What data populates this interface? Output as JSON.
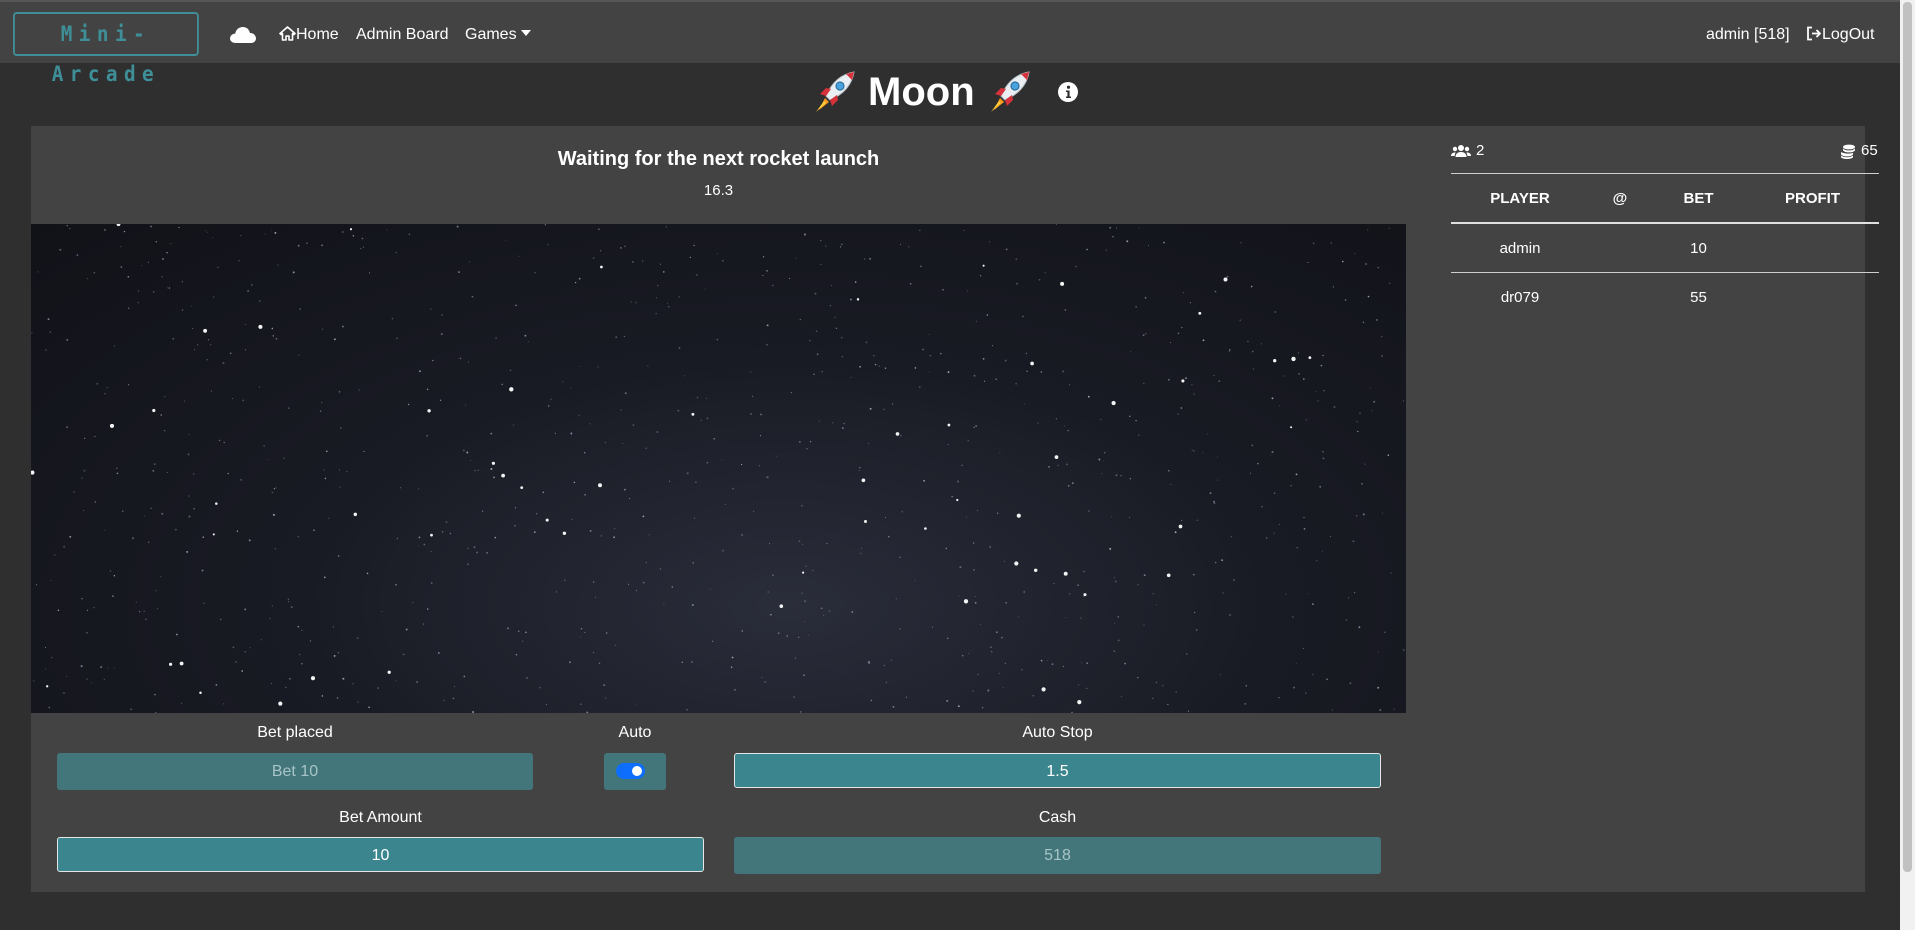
{
  "navbar": {
    "brand": "Mini-Arcade",
    "cloud_icon": "cloud-icon",
    "home_label": "Home",
    "admin_board_label": "Admin Board",
    "games_label": "Games",
    "user_label": "admin [518]",
    "logout_label": "LogOut"
  },
  "page": {
    "title": "Moon",
    "title_icon": "rocket-icon",
    "info_icon": "info-icon"
  },
  "game": {
    "status_text": "Waiting for the next rocket launch",
    "countdown": "16.3"
  },
  "controls": {
    "bet_placed_label": "Bet placed",
    "bet_placed_value": "Bet 10",
    "auto_label": "Auto",
    "auto_enabled": true,
    "auto_stop_label": "Auto Stop",
    "auto_stop_value": "1.5",
    "bet_amount_label": "Bet Amount",
    "bet_amount_value": "10",
    "cash_label": "Cash",
    "cash_value": "518"
  },
  "players": {
    "player_count": "2",
    "total_bet": "65",
    "columns": [
      "PLAYER",
      "@",
      "BET",
      "PROFIT"
    ],
    "rows": [
      {
        "player": "admin",
        "at": "",
        "bet": "10",
        "profit": ""
      },
      {
        "player": "dr079",
        "at": "",
        "bet": "55",
        "profit": ""
      }
    ]
  },
  "colors": {
    "background": "#2f2f2f",
    "panel": "#434343",
    "accent": "#3b868e",
    "toggle": "#0d6efd"
  }
}
